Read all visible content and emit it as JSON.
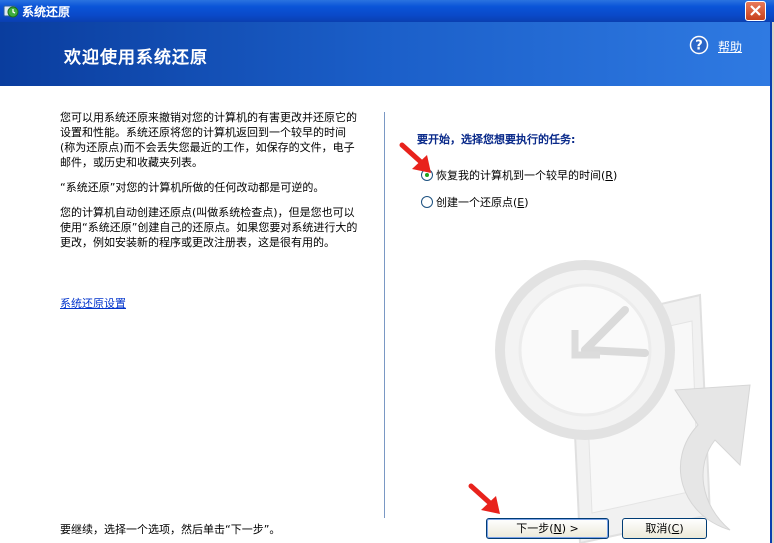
{
  "window": {
    "title": "系统还原",
    "close_icon": "close-icon"
  },
  "banner": {
    "title": "欢迎使用系统还原",
    "help_label": "帮助"
  },
  "left": {
    "paragraph1": "您可以用系统还原来撤销对您的计算机的有害更改并还原它的设置和性能。系统还原将您的计算机返回到一个较早的时间(称为还原点)而不会丢失您最近的工作，如保存的文件，电子邮件，或历史和收藏夹列表。",
    "paragraph2": "“系统还原”对您的计算机所做的任何改动都是可逆的。",
    "paragraph3": "您的计算机自动创建还原点(叫做系统检查点)，但是您也可以使用“系统还原”创建自己的还原点。如果您要对系统进行大的更改，例如安装新的程序或更改注册表，这是很有用的。",
    "settings_link": "系统还原设置"
  },
  "right": {
    "prompt": "要开始，选择您想要执行的任务:",
    "options": [
      {
        "label": "恢复我的计算机到一个较早的时间(",
        "key": "R",
        "suffix": ")",
        "checked": true
      },
      {
        "label": "创建一个还原点(",
        "key": "E",
        "suffix": ")",
        "checked": false
      }
    ]
  },
  "footer": {
    "hint": "要继续，选择一个选项，然后单击“下一步”。",
    "next": {
      "label": "下一步(",
      "key": "N",
      "suffix": ") >"
    },
    "cancel": {
      "label": "取消(",
      "key": "C",
      "suffix": ")"
    }
  },
  "colors": {
    "annotation_arrow": "#e8221c",
    "banner": "#1b5fc9",
    "prompt_text": "#0a2a8a"
  }
}
